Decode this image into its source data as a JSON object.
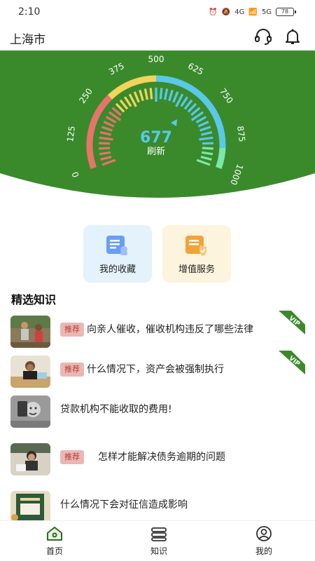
{
  "status_bar": {
    "time": "2:10",
    "battery": "78",
    "net_a": "4G",
    "net_b": "5G"
  },
  "header": {
    "city": "上海市"
  },
  "score": {
    "value": "677",
    "refresh_label": "刷新",
    "ticks": [
      "0",
      "125",
      "250",
      "375",
      "500",
      "625",
      "750",
      "875",
      "1000"
    ],
    "colors": {
      "low": "#e8736b",
      "mid": "#f2d45c",
      "high": "#5ac8e8",
      "top": "#7be8a8"
    }
  },
  "quick_actions": [
    {
      "label": "我的收藏",
      "icon": "bookmark-icon"
    },
    {
      "label": "增值服务",
      "icon": "service-icon"
    }
  ],
  "section": {
    "title": "精选知识"
  },
  "articles": [
    {
      "tag": "推荐",
      "title": "向亲人催收，催收机构违反了哪些法律",
      "vip": "VIP"
    },
    {
      "tag": "推荐",
      "title": "什么情况下，资产会被强制执行",
      "vip": "VIP"
    },
    {
      "tag": "",
      "title": "贷款机构不能收取的费用!",
      "vip": ""
    },
    {
      "tag": "推荐",
      "title": "怎样才能解决债务逾期的问题",
      "vip": ""
    },
    {
      "tag": "",
      "title": "什么情况下会对征信造成影响",
      "vip": ""
    }
  ],
  "nav": [
    {
      "label": "首页",
      "icon": "home-icon"
    },
    {
      "label": "知识",
      "icon": "book-icon"
    },
    {
      "label": "我的",
      "icon": "profile-icon"
    }
  ],
  "colors": {
    "brand_green": "#3a8a2c",
    "tag_bg": "#e9b8b6",
    "tag_text": "#c0392b",
    "score_text": "#5ac8e8"
  }
}
